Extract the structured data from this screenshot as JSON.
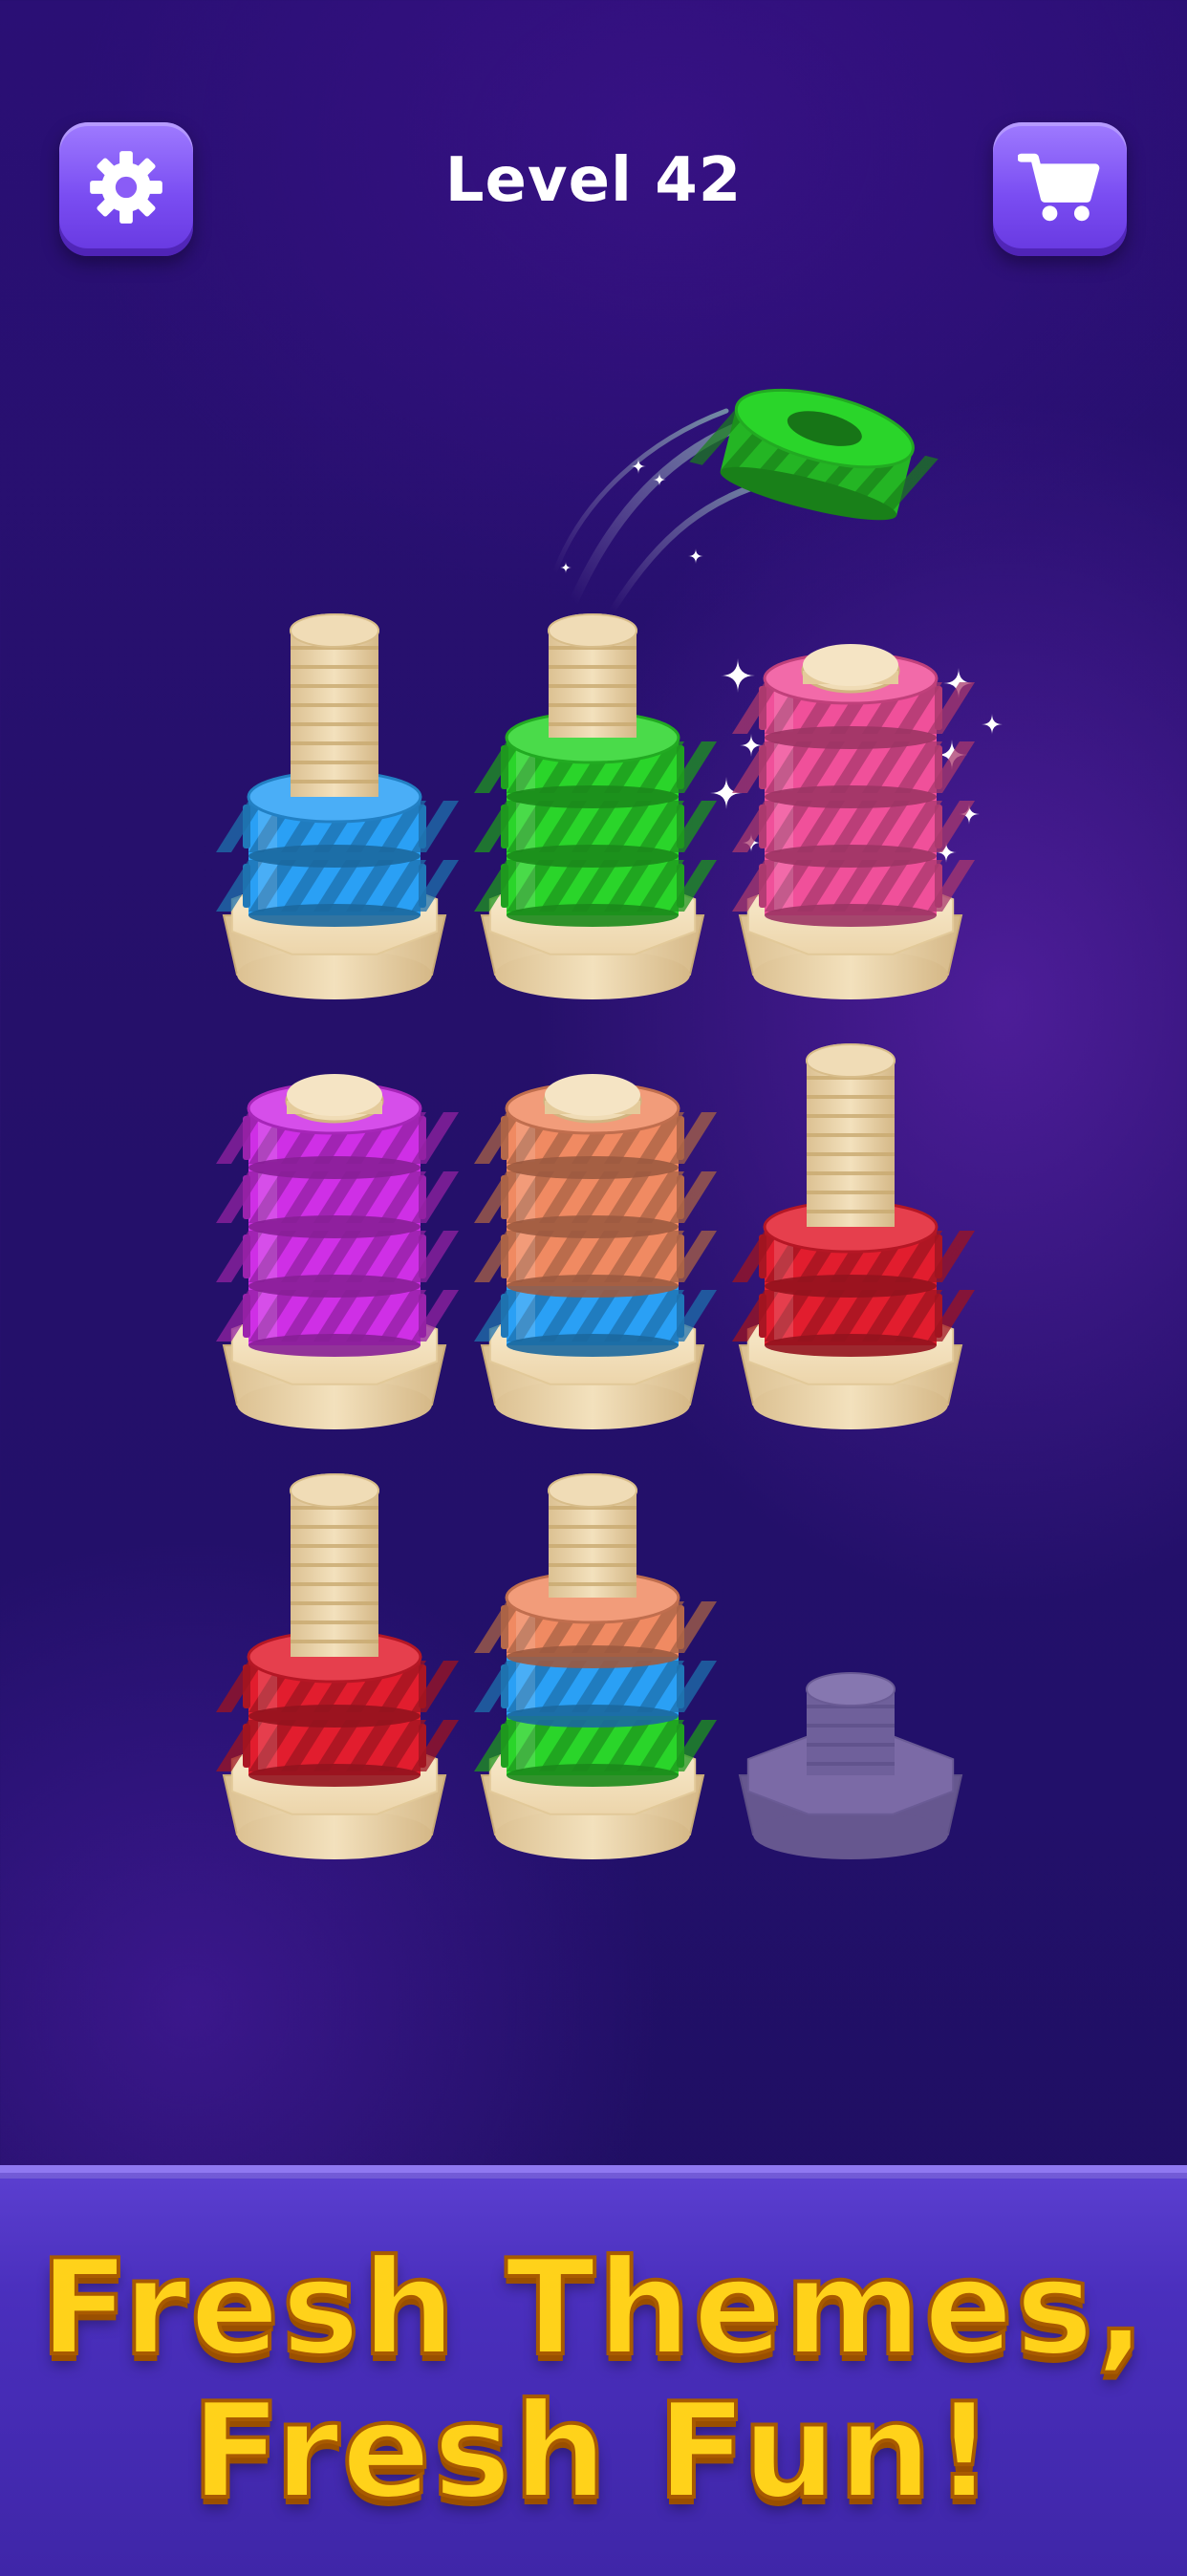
{
  "header": {
    "level_label": "Level 42",
    "settings_icon": "gear-icon",
    "shop_icon": "cart-icon"
  },
  "colors": {
    "blue": "#2aa0f5",
    "green": "#2ad52a",
    "pink": "#f0509a",
    "purple": "#cf2fe6",
    "orange": "#f08a62",
    "red": "#e21d2e",
    "wood": "#f0dcb6",
    "ghost": "#7a6aa8"
  },
  "board": {
    "selected_nut": "green",
    "pegs": [
      {
        "id": 1,
        "stack": [
          "blue",
          "blue"
        ]
      },
      {
        "id": 2,
        "stack": [
          "green",
          "green",
          "green"
        ]
      },
      {
        "id": 3,
        "stack": [
          "pink",
          "pink",
          "pink",
          "pink"
        ],
        "completed": true
      },
      {
        "id": 4,
        "stack": [
          "purple",
          "purple",
          "purple",
          "purple"
        ],
        "completed": true
      },
      {
        "id": 5,
        "stack": [
          "blue",
          "orange",
          "orange",
          "orange"
        ]
      },
      {
        "id": 6,
        "stack": [
          "red",
          "red"
        ]
      },
      {
        "id": 7,
        "stack": [
          "red",
          "red"
        ]
      },
      {
        "id": 8,
        "stack": [
          "green",
          "blue",
          "orange"
        ]
      },
      {
        "id": 9,
        "stack": [],
        "locked": true
      }
    ]
  },
  "banner": {
    "line1": "Fresh Themes,",
    "line2": "Fresh Fun!"
  }
}
